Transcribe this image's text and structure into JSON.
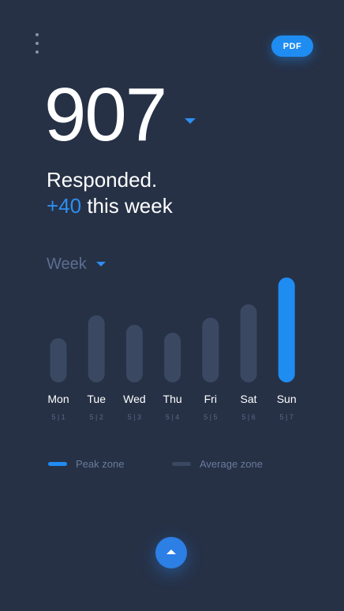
{
  "header": {
    "menu_icon": "more-vertical-icon",
    "pdf_label": "PDF"
  },
  "summary": {
    "total": "907",
    "dropdown_icon": "caret-down-icon",
    "label": "Responded.",
    "delta": "+40",
    "delta_suffix": " this week"
  },
  "period": {
    "selected": "Week",
    "dropdown_icon": "caret-down-icon"
  },
  "colors": {
    "background": "#263146",
    "accent": "#1f8cf2",
    "average_bar": "#3a4862",
    "muted_text": "#6a7a99"
  },
  "chart_data": {
    "type": "bar",
    "categories": [
      "Mon",
      "Tue",
      "Wed",
      "Thu",
      "Fri",
      "Sat",
      "Sun"
    ],
    "dates": [
      "5 | 1",
      "5 | 2",
      "5 | 3",
      "5 | 4",
      "5 | 5",
      "5 | 6",
      "5 | 7"
    ],
    "values": [
      56,
      85,
      73,
      63,
      82,
      99,
      133
    ],
    "highlight": "Sun",
    "ylim": [
      0,
      133
    ],
    "grid": false,
    "legend_position": "bottom"
  },
  "legend": [
    {
      "label": "Peak zone",
      "color": "#1f8cf2"
    },
    {
      "label": "Average zone",
      "color": "#3a4862"
    }
  ],
  "footer": {
    "scroll_up_icon": "chevron-up-icon"
  }
}
